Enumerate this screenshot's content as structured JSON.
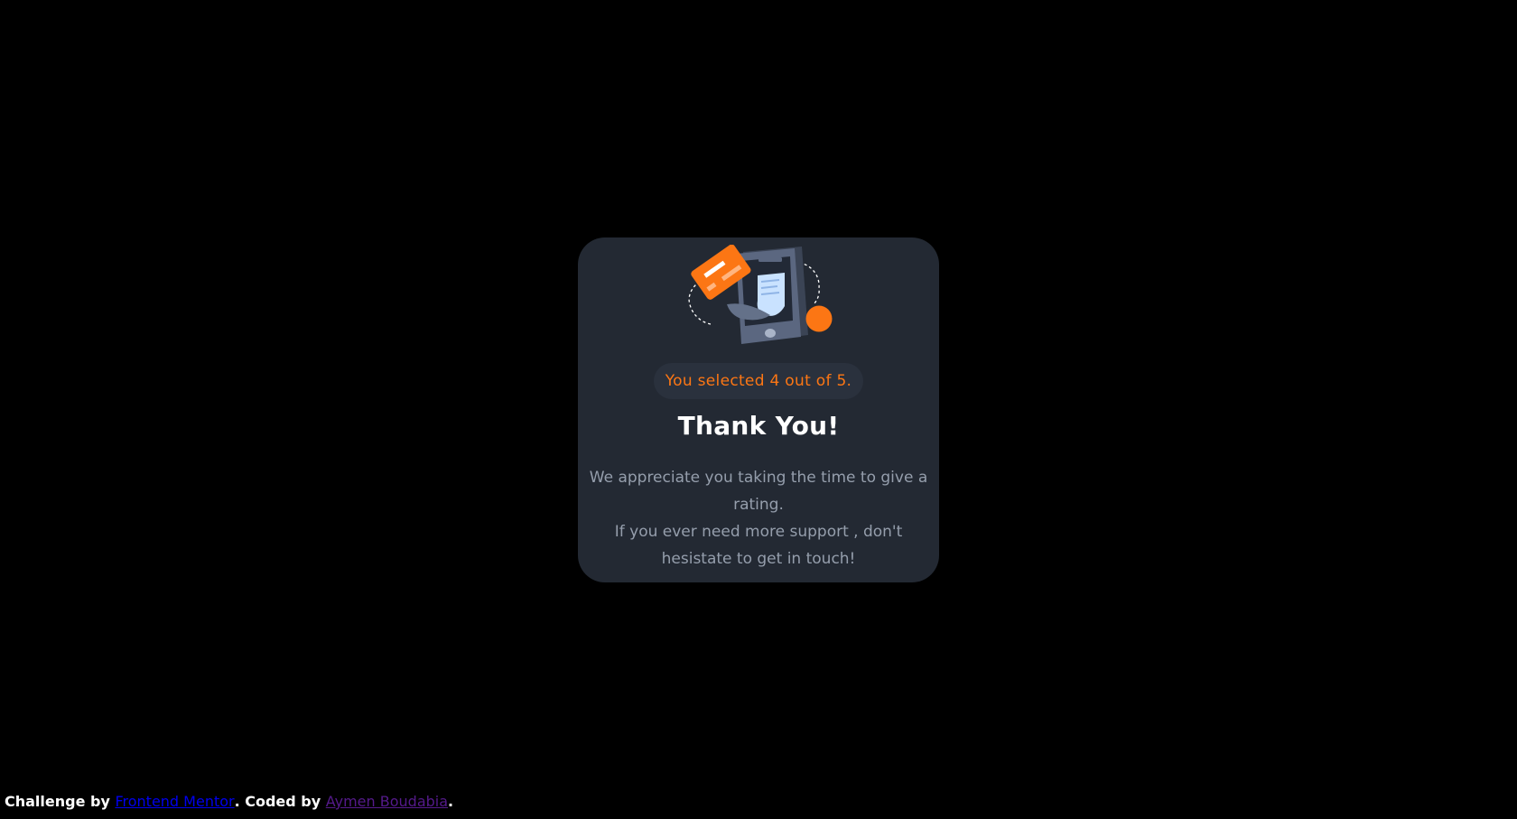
{
  "card": {
    "illustration_icon": "phone-receipt-illustration",
    "selected_text": "You selected 4 out of 5.",
    "rating": 4,
    "rating_max": 5,
    "title": "Thank You!",
    "message_line_1": "We appreciate you taking the time to give a rating.",
    "message_line_2": "If you ever need more support , don't hesistate to get in touch!"
  },
  "attribution": {
    "prefix": "Challenge by ",
    "challenge_link": "Frontend Mentor",
    "middle": ". Coded by ",
    "author_link": "Aymen Boudabia",
    "suffix": "."
  },
  "colors": {
    "background": "#000000",
    "card": "#232933",
    "accent": "#fc7614",
    "muted_text": "#959eac"
  }
}
